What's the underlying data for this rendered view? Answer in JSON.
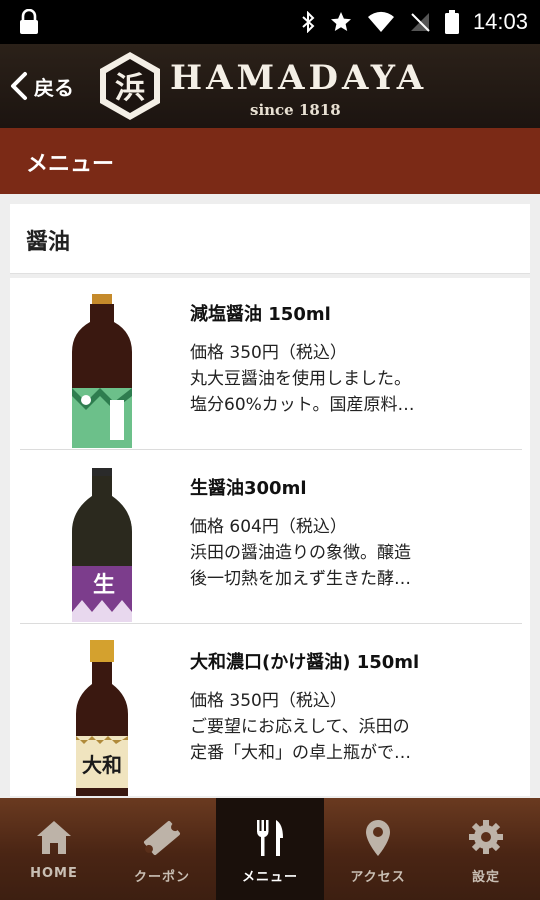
{
  "status": {
    "time": "14:03"
  },
  "header": {
    "back_label": "戻る",
    "logo_char": "浜",
    "brand": "HAMADAYA",
    "since": "since 1818"
  },
  "page_title": "メニュー",
  "category": "醤油",
  "products": [
    {
      "name": "減塩醤油 150ml",
      "price": "価格 350円（税込）",
      "desc1": "丸大豆醤油を使用しました。",
      "desc2": "塩分60%カット。国産原料…",
      "label_char": ""
    },
    {
      "name": "生醤油300ml",
      "price": "価格 604円（税込）",
      "desc1": "浜田の醤油造りの象徴。醸造",
      "desc2": "後一切熱を加えず生きた酵…",
      "label_char": "生"
    },
    {
      "name": "大和濃口(かけ醤油) 150ml",
      "price": "価格 350円（税込）",
      "desc1": "ご要望にお応えして、浜田の",
      "desc2": "定番「大和」の卓上瓶がで…",
      "label_char": "大和"
    }
  ],
  "nav": [
    {
      "label": "HOME",
      "icon": "home-icon",
      "active": false
    },
    {
      "label": "クーポン",
      "icon": "ticket-icon",
      "active": false
    },
    {
      "label": "メニュー",
      "icon": "fork-knife-icon",
      "active": true
    },
    {
      "label": "アクセス",
      "icon": "map-pin-icon",
      "active": false
    },
    {
      "label": "設定",
      "icon": "gear-icon",
      "active": false
    }
  ],
  "colors": {
    "titlebar": "#7b2a16",
    "header": "#1c1410",
    "nav": "#4a2514"
  }
}
